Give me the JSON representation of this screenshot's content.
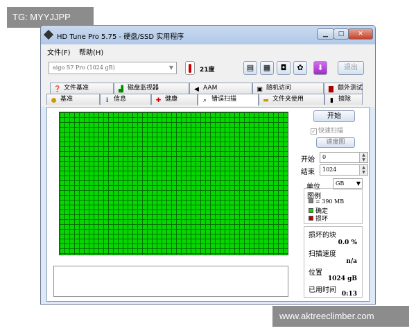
{
  "overlays": {
    "top_left_tag": "TG: MYYJJPP",
    "bottom_right_tag": "www.aktreeclimber.com"
  },
  "window": {
    "title": "HD Tune Pro 5.75 - 硬盘/SSD 实用程序",
    "controls": {
      "minimize": "▁",
      "maximize": "□",
      "close": "✕"
    }
  },
  "menu": {
    "items": [
      "文件(F)",
      "帮助(H)"
    ]
  },
  "toolbar": {
    "drive": "aigo    S7 Pro (1024 gB)",
    "temperature": "21度",
    "exit_label": "退出",
    "buttons": [
      "copy-info",
      "copy-screen",
      "screenshot-camera",
      "options",
      "download"
    ]
  },
  "tabs": {
    "row1": [
      {
        "label": "文件基准",
        "icon": "file-benchmark-icon"
      },
      {
        "label": "磁盘监视器",
        "icon": "disk-monitor-icon"
      },
      {
        "label": "AAM",
        "icon": "speaker-icon"
      },
      {
        "label": "随机访问",
        "icon": "random-access-icon"
      },
      {
        "label": "额外测试",
        "icon": "extra-tests-icon"
      }
    ],
    "row2": [
      {
        "label": "基准",
        "icon": "benchmark-icon"
      },
      {
        "label": "信息",
        "icon": "info-icon"
      },
      {
        "label": "健康",
        "icon": "health-icon"
      },
      {
        "label": "错误扫描",
        "icon": "magnifier-icon",
        "active": true
      },
      {
        "label": "文件夹使用",
        "icon": "folder-icon"
      },
      {
        "label": "擦除",
        "icon": "trash-icon"
      }
    ]
  },
  "error_scan": {
    "start_button": "开始",
    "quick_scan_label": "快速扫描",
    "quick_scan_checked": true,
    "map_button": "速度图",
    "start_label": "开始",
    "start_value": "0",
    "end_label": "结束",
    "end_value": "1024",
    "unit_label": "单位",
    "unit_value": "GB",
    "legend": {
      "title": "图例",
      "block_size": "= 390 MB",
      "ok_label": "确定",
      "damaged_label": "损坏"
    },
    "stats": {
      "damaged_blocks_label": "损坏的块",
      "damaged_blocks_value": "0.0 %",
      "scan_speed_label": "扫描速度",
      "scan_speed_value": "n/a",
      "position_label": "位置",
      "position_value": "1024 gB",
      "elapsed_label": "已用时间",
      "elapsed_value": "0:13"
    }
  },
  "colors": {
    "ok_block": "#06d700",
    "damaged_block": "#c00000",
    "block_size_swatch": "#808080"
  }
}
